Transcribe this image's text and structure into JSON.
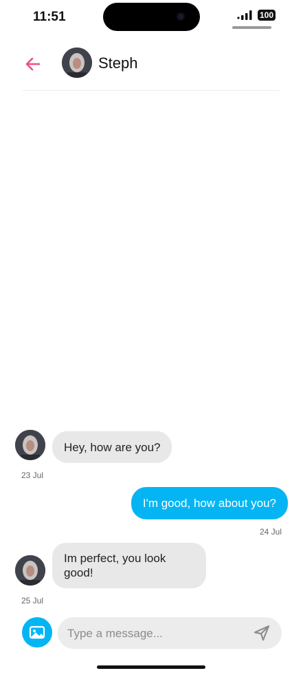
{
  "status_bar": {
    "time": "11:51",
    "battery": "100"
  },
  "header": {
    "contact_name": "Steph"
  },
  "messages": [
    {
      "direction": "incoming",
      "text": "Hey, how are you?",
      "date": "23 Jul"
    },
    {
      "direction": "outgoing",
      "text": "I'm good, how about you?",
      "date": "24 Jul"
    },
    {
      "direction": "incoming",
      "text": "Im perfect, you look good!",
      "date": "25 Jul"
    }
  ],
  "composer": {
    "placeholder": "Type a message..."
  },
  "colors": {
    "accent_back": "#ec4f7c",
    "bubble_out": "#05b5f3",
    "bubble_in": "#e8e8e8"
  },
  "icons": {
    "back": "arrow-left-icon",
    "photo": "image-icon",
    "send": "send-icon"
  }
}
